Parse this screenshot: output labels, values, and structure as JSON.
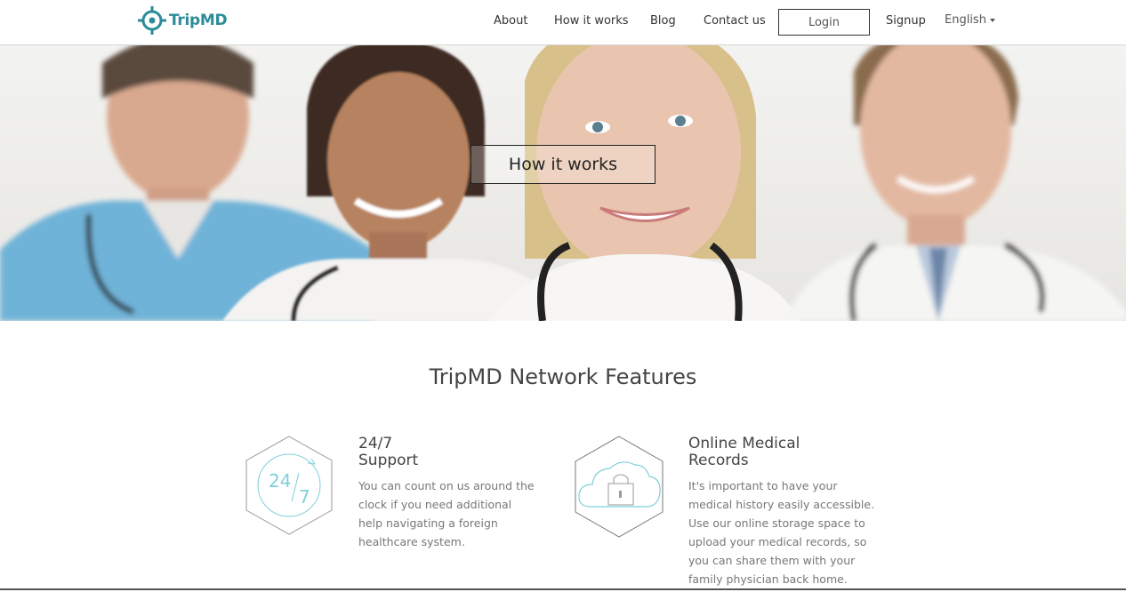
{
  "brand": {
    "name_part1": "Trip",
    "name_part2": "MD"
  },
  "nav": {
    "about": "About",
    "how_it_works": "How it works",
    "blog": "Blog",
    "contact": "Contact us",
    "login": "Login",
    "signup": "Signup",
    "language": "English"
  },
  "hero": {
    "cta": "How it works"
  },
  "features": {
    "title": "TripMD Network Features",
    "items": [
      {
        "title_line1": "24/7",
        "title_line2": "Support",
        "icon_text_a": "24",
        "icon_text_b": "7",
        "desc": "You can count on us around the clock if you need additional help navigating a foreign healthcare system.",
        "icon": "clock-24-7-icon"
      },
      {
        "title_line1": "Online Medical",
        "title_line2": "Records",
        "desc": "It's important to have your medical history easily accessible. Use our online storage space to upload your medical records, so you can share them with your family physician back home.",
        "icon": "cloud-lock-icon"
      }
    ]
  },
  "colors": {
    "brand": "#2b8c98",
    "accent_teal": "#4fb8c2"
  }
}
